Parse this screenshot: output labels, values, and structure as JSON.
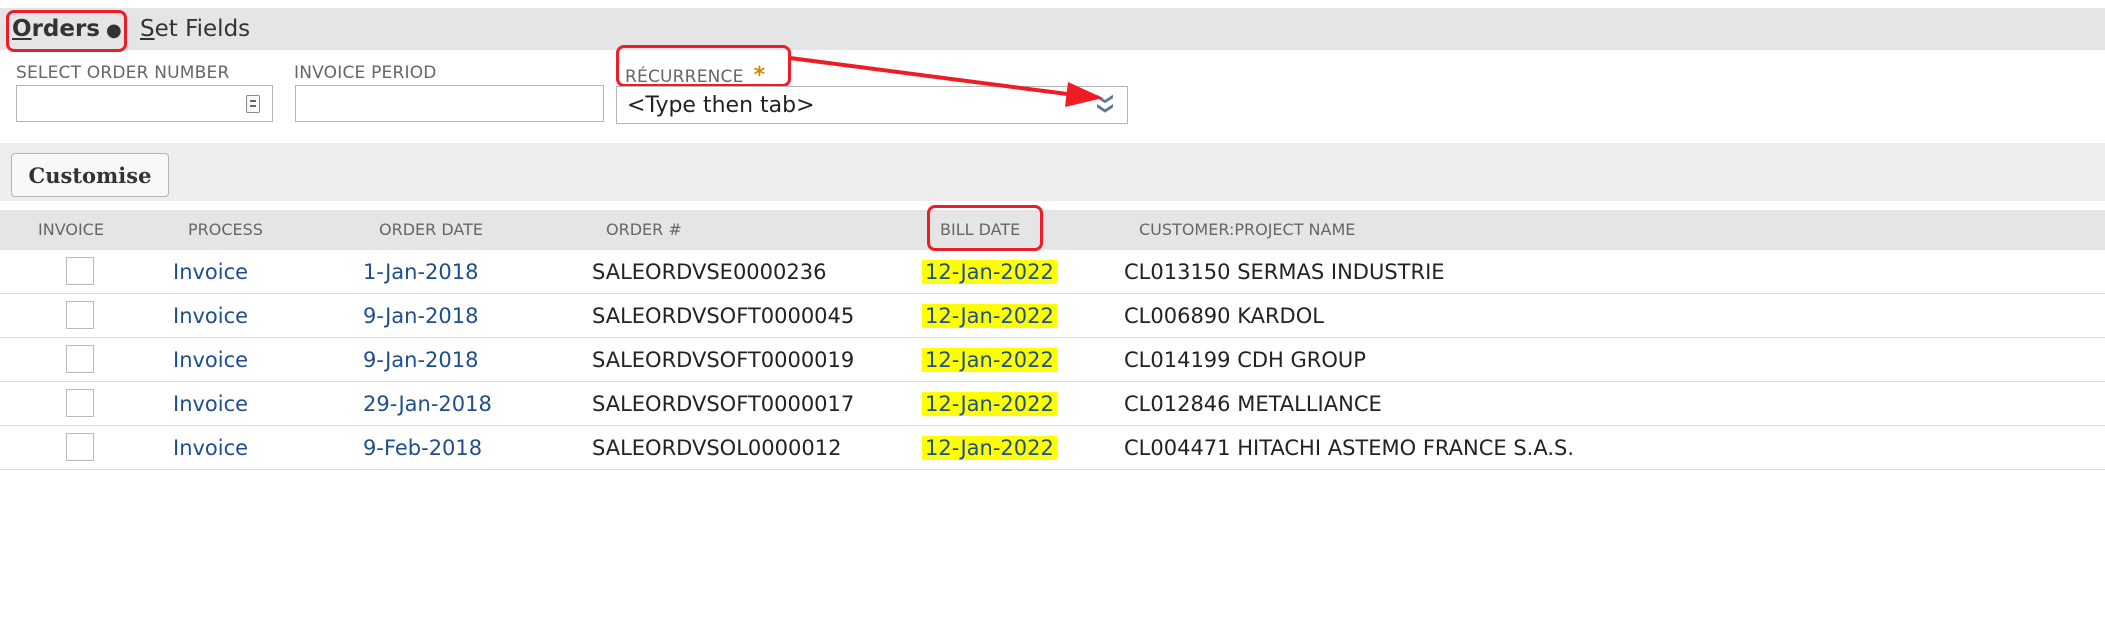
{
  "tabs": {
    "orders_first": "O",
    "orders_rest": "rders",
    "orders_dot": "●",
    "set_first": "S",
    "set_rest": "et Fields"
  },
  "filters": {
    "order_number_label": "SELECT ORDER NUMBER",
    "order_number_value": "",
    "invoice_period_label": "INVOICE PERIOD",
    "invoice_period_value": "",
    "recurrence_label": "RÉCURRENCE",
    "recurrence_required": "*",
    "recurrence_value": "<Type then tab>",
    "recurrence_chevron": "❯❯"
  },
  "toolbar": {
    "customise_label": "Customise"
  },
  "table": {
    "columns": [
      "INVOICE",
      "PROCESS",
      "ORDER DATE",
      "ORDER #",
      "BILL DATE",
      "CUSTOMER:PROJECT NAME"
    ],
    "rows": [
      {
        "invoice": false,
        "process": "Invoice",
        "order_date": "1-Jan-2018",
        "order_no": "SALEORDVSE0000236",
        "bill_date": "12-Jan-2022",
        "customer": "CL013150 SERMAS INDUSTRIE"
      },
      {
        "invoice": false,
        "process": "Invoice",
        "order_date": "9-Jan-2018",
        "order_no": "SALEORDVSOFT0000045",
        "bill_date": "12-Jan-2022",
        "customer": "CL006890 KARDOL"
      },
      {
        "invoice": false,
        "process": "Invoice",
        "order_date": "9-Jan-2018",
        "order_no": "SALEORDVSOFT0000019",
        "bill_date": "12-Jan-2022",
        "customer": "CL014199 CDH GROUP"
      },
      {
        "invoice": false,
        "process": "Invoice",
        "order_date": "29-Jan-2018",
        "order_no": "SALEORDVSOFT0000017",
        "bill_date": "12-Jan-2022",
        "customer": "CL012846 METALLIANCE"
      },
      {
        "invoice": false,
        "process": "Invoice",
        "order_date": "9-Feb-2018",
        "order_no": "SALEORDVSOL0000012",
        "bill_date": "12-Jan-2022",
        "customer": "CL004471 HITACHI ASTEMO FRANCE S.A.S."
      }
    ]
  },
  "colors": {
    "annotation_red": "#ee1c24",
    "highlight_yellow": "#ffff00",
    "link_blue": "#1f4e8c",
    "required_star": "#d48a00"
  }
}
